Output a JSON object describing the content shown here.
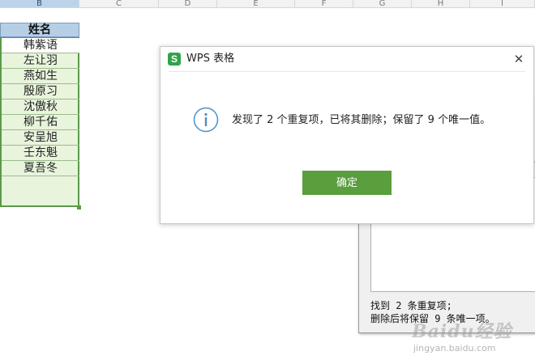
{
  "sheet": {
    "columns": [
      "B",
      "C",
      "D",
      "E",
      "F",
      "G",
      "H",
      "I"
    ],
    "column_b": {
      "header": "姓名",
      "names": [
        "韩紫语",
        "左让羽",
        "燕如生",
        "殷原习",
        "沈傲秋",
        "柳千佑",
        "安呈旭",
        "壬东魁",
        "夏吾冬"
      ]
    }
  },
  "bg_dialog": {
    "line1": "找到 2 条重复项;",
    "line2": "删除后将保留 9 条唯一项。"
  },
  "dialog": {
    "title": "WPS 表格",
    "logo_letter": "S",
    "close_glyph": "✕",
    "message": "发现了 2 个重复项，已将其删除；保留了 9 个唯一值。",
    "ok_label": "确定",
    "icons": {
      "info": "info-icon",
      "close": "close-icon"
    },
    "colors": {
      "accent": "#5a9e3e",
      "logo": "#33a24a",
      "info": "#4a90c8"
    }
  },
  "watermark": {
    "text": "Baidu经验",
    "sub": "jingyan.baidu.com"
  }
}
